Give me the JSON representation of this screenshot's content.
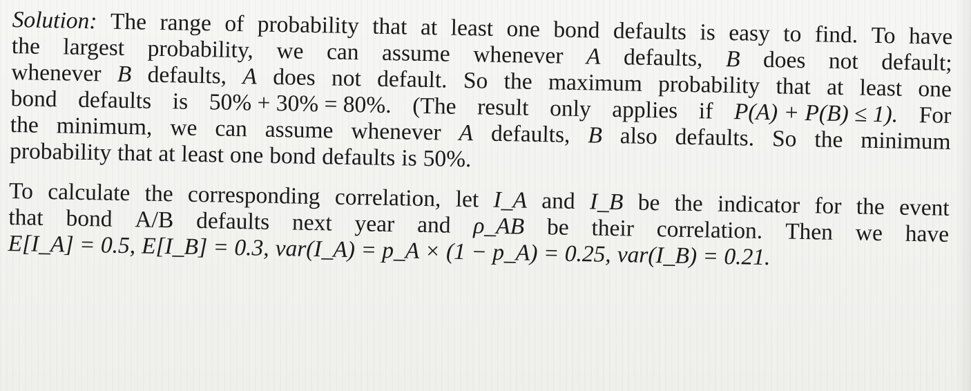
{
  "document": {
    "paragraphs": [
      {
        "lines": [
          {
            "last": false,
            "words": [
              {
                "t": "Solution:",
                "i": true
              },
              {
                "t": "The"
              },
              {
                "t": "range"
              },
              {
                "t": "of"
              },
              {
                "t": "probability"
              },
              {
                "t": "that"
              },
              {
                "t": "at"
              },
              {
                "t": "least"
              },
              {
                "t": "one"
              },
              {
                "t": "bond"
              },
              {
                "t": "defaults"
              },
              {
                "t": "is"
              },
              {
                "t": "easy"
              },
              {
                "t": "to"
              },
              {
                "t": "find."
              },
              {
                "t": "To"
              },
              {
                "t": "have"
              }
            ]
          },
          {
            "last": false,
            "words": [
              {
                "t": "the"
              },
              {
                "t": "largest"
              },
              {
                "t": "probability,"
              },
              {
                "t": "we"
              },
              {
                "t": "can"
              },
              {
                "t": "assume"
              },
              {
                "t": "whenever"
              },
              {
                "t": "A",
                "i": true
              },
              {
                "t": "defaults,"
              },
              {
                "t": "B",
                "i": true
              },
              {
                "t": "does"
              },
              {
                "t": "not"
              },
              {
                "t": "default;"
              }
            ]
          },
          {
            "last": false,
            "words": [
              {
                "t": "whenever"
              },
              {
                "t": "B",
                "i": true
              },
              {
                "t": "defaults,"
              },
              {
                "t": "A",
                "i": true
              },
              {
                "t": "does"
              },
              {
                "t": "not"
              },
              {
                "t": "default."
              },
              {
                "t": "So"
              },
              {
                "t": "the"
              },
              {
                "t": "maximum"
              },
              {
                "t": "probability"
              },
              {
                "t": "that"
              },
              {
                "t": "at"
              },
              {
                "t": "least"
              },
              {
                "t": "one"
              }
            ]
          },
          {
            "last": false,
            "words": [
              {
                "t": "bond"
              },
              {
                "t": "defaults"
              },
              {
                "t": "is"
              },
              {
                "t": "50% + 30% = 80%."
              },
              {
                "t": "(The"
              },
              {
                "t": "result"
              },
              {
                "t": "only"
              },
              {
                "t": "applies"
              },
              {
                "t": "if"
              },
              {
                "t": "P(A) + P(B) ≤ 1).",
                "i": true
              },
              {
                "t": "For"
              }
            ]
          },
          {
            "last": false,
            "words": [
              {
                "t": "the"
              },
              {
                "t": "minimum,"
              },
              {
                "t": "we"
              },
              {
                "t": "can"
              },
              {
                "t": "assume"
              },
              {
                "t": "whenever"
              },
              {
                "t": "A",
                "i": true
              },
              {
                "t": "defaults,"
              },
              {
                "t": "B",
                "i": true
              },
              {
                "t": "also"
              },
              {
                "t": "defaults."
              },
              {
                "t": "So"
              },
              {
                "t": "the"
              },
              {
                "t": "minimum"
              }
            ]
          },
          {
            "last": true,
            "words": [
              {
                "t": "probability"
              },
              {
                "t": "that"
              },
              {
                "t": "at"
              },
              {
                "t": "least"
              },
              {
                "t": "one"
              },
              {
                "t": "bond"
              },
              {
                "t": "defaults"
              },
              {
                "t": "is"
              },
              {
                "t": "50%."
              }
            ]
          }
        ]
      },
      {
        "lines": [
          {
            "last": false,
            "words": [
              {
                "t": "To"
              },
              {
                "t": "calculate"
              },
              {
                "t": "the"
              },
              {
                "t": "corresponding"
              },
              {
                "t": "correlation,"
              },
              {
                "t": "let"
              },
              {
                "t": "I_A",
                "i": true
              },
              {
                "t": "and"
              },
              {
                "t": "I_B",
                "i": true
              },
              {
                "t": "be"
              },
              {
                "t": "the"
              },
              {
                "t": "indicator"
              },
              {
                "t": "for"
              },
              {
                "t": "the"
              },
              {
                "t": "event"
              }
            ]
          },
          {
            "last": false,
            "words": [
              {
                "t": "that"
              },
              {
                "t": "bond"
              },
              {
                "t": "A/B"
              },
              {
                "t": "defaults"
              },
              {
                "t": "next"
              },
              {
                "t": "year"
              },
              {
                "t": "and"
              },
              {
                "t": "ρ_AB",
                "i": true
              },
              {
                "t": "be"
              },
              {
                "t": "their"
              },
              {
                "t": "correlation."
              },
              {
                "t": "Then"
              },
              {
                "t": "we"
              },
              {
                "t": "have"
              }
            ]
          },
          {
            "last": true,
            "words": [
              {
                "t": "E[I_A] = 0.5,",
                "i": true
              },
              {
                "t": "E[I_B] = 0.3,",
                "i": true
              },
              {
                "t": "var(I_A) = p_A × (1 − p_A) = 0.25,",
                "i": true
              },
              {
                "t": "var(I_B) = 0.21.",
                "i": true
              }
            ]
          }
        ]
      }
    ]
  }
}
